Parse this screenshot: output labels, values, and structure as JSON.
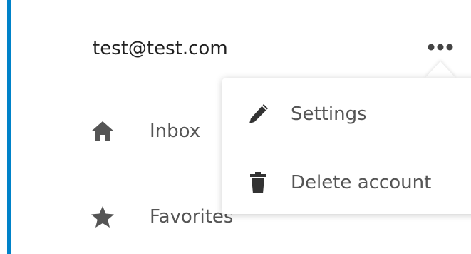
{
  "account": {
    "email": "test@test.com"
  },
  "navigation": {
    "items": [
      {
        "label": "Inbox",
        "icon": "home-icon"
      },
      {
        "label": "Favorites",
        "icon": "star-icon"
      }
    ]
  },
  "account_menu": {
    "items": [
      {
        "label": "Settings",
        "icon": "pencil-icon"
      },
      {
        "label": "Delete account",
        "icon": "trash-icon"
      }
    ]
  },
  "colors": {
    "accent": "#0082c9",
    "text_primary": "#222222",
    "text_secondary": "#555555"
  }
}
